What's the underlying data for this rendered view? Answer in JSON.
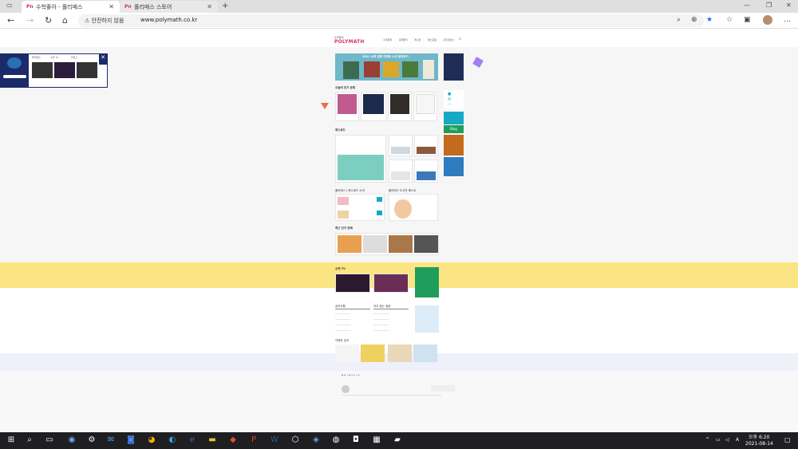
{
  "browser": {
    "tabs": [
      {
        "label": "수학좋아 - 폴리매스",
        "favicon": "Pn"
      },
      {
        "label": "폴리매스 스토어",
        "favicon": "Pn"
      }
    ],
    "security_text": "안전하지 않음",
    "url": "www.polymath.co.kr"
  },
  "site": {
    "logo_text": "POLYMATH",
    "logo_small": "수학좋아",
    "nav": [
      "수학문제",
      "문제풀기",
      "게시판",
      "매스포럼",
      "수학콘텐츠"
    ],
    "banner_title": "2021 수학 관련 이벤트 소식 알아보기",
    "sections": {
      "popular": "오늘의 인기 문제",
      "webzine": "매스로드",
      "polymath_talk": "폴리매스 | 매스로드 소개",
      "library": "폴리매스 도서관 베스트",
      "recommended": "최근 인기 문제",
      "mathtv": "수학 TV",
      "notices": "공지사항",
      "qna": "자주 묻는 질문",
      "events": "이벤트 공지"
    },
    "side_labels": {
      "blog": "Blog"
    }
  },
  "popup": {
    "tabs": [
      "폴리매스",
      "수학 TV",
      "블로그"
    ],
    "close": "✕"
  },
  "colors": {
    "accent": "#e1306c",
    "navy": "#1b2a6b",
    "yellow_band": "#fbe582",
    "green": "#1e9e5a",
    "teal": "#16a9c4"
  },
  "taskbar": {
    "time": "오후 6:20",
    "date": "2021-08-14",
    "ime": "A"
  }
}
